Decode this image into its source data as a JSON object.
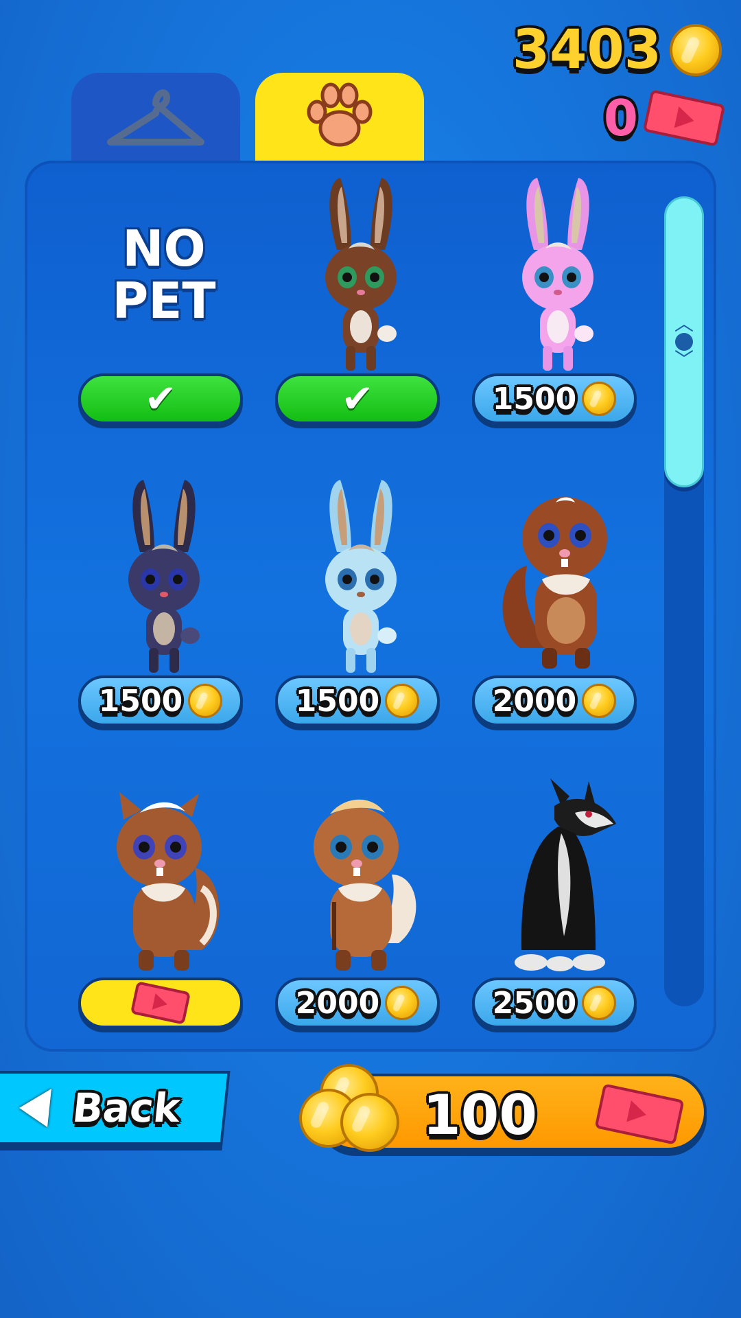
{
  "currency": {
    "coins": "3403",
    "tickets": "0",
    "coin_icon": "gold-coin",
    "ticket_icon": "pink-video-ticket"
  },
  "tabs": [
    {
      "name": "outfits",
      "icon": "hanger",
      "selected": false,
      "color": "#1f56c6"
    },
    {
      "name": "pets",
      "icon": "paw",
      "selected": true,
      "color": "#ffe41a"
    }
  ],
  "pets": [
    {
      "label": "NO PET",
      "state": "owned",
      "price": null
    },
    {
      "name": "brown bunny",
      "state": "owned",
      "price": null
    },
    {
      "name": "pink bunny",
      "state": "price",
      "price": "1500"
    },
    {
      "name": "navy bunny",
      "state": "price",
      "price": "1500"
    },
    {
      "name": "light blue bunny",
      "state": "price",
      "price": "1500"
    },
    {
      "name": "brown squirrel",
      "state": "price",
      "price": "2000"
    },
    {
      "name": "brown squirrel white tuft",
      "state": "video",
      "price": null
    },
    {
      "name": "chipmunk",
      "state": "price",
      "price": "2000"
    },
    {
      "name": "black wolf",
      "state": "price",
      "price": "2500"
    }
  ],
  "footer": {
    "back_label": "Back",
    "reward_amount": "100"
  },
  "colors": {
    "owned_green": "#13bd13",
    "price_blue": "#3ba7ea",
    "reward_orange": "#ff9800",
    "back_cyan": "#00c8ff"
  }
}
